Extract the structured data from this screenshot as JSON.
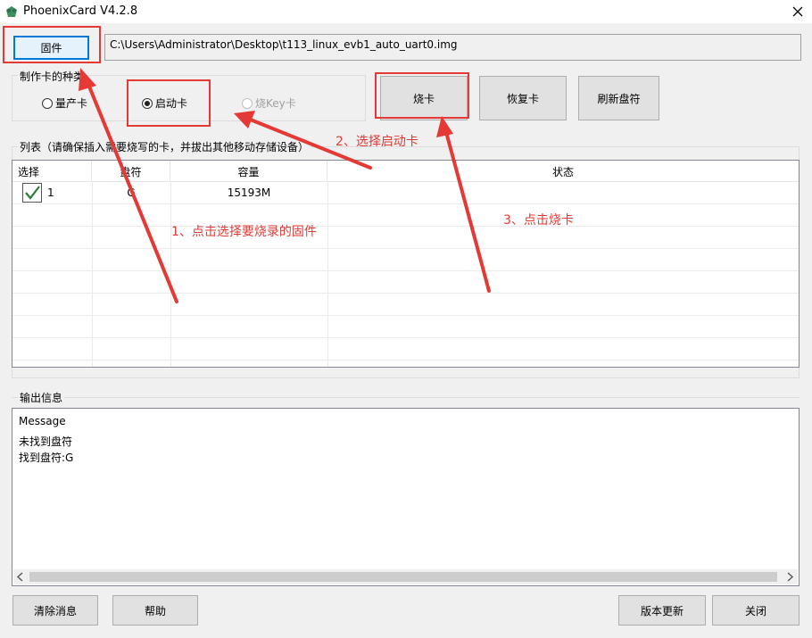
{
  "window": {
    "title": "PhoenixCard V4.2.8"
  },
  "firmware": {
    "button_label": "固件",
    "path": "C:\\Users\\Administrator\\Desktop\\t113_linux_evb1_auto_uart0.img"
  },
  "card_type": {
    "group_label": "制作卡的种类",
    "options": [
      "量产卡",
      "启动卡",
      "烧Key卡"
    ],
    "selected": "启动卡"
  },
  "actions": {
    "burn": "烧卡",
    "restore": "恢复卡",
    "refresh": "刷新盘符"
  },
  "list": {
    "group_label": "列表（请确保插入需要烧写的卡，并拔出其他移动存储设备）",
    "columns": [
      "选择",
      "盘符",
      "容量",
      "状态"
    ],
    "rows": [
      {
        "index": "1",
        "drive": "G",
        "capacity": "15193M",
        "status": "",
        "checked": true
      }
    ]
  },
  "output": {
    "group_label": "输出信息",
    "lines": [
      "Message",
      "未找到盘符",
      "找到盘符:G"
    ]
  },
  "bottom": {
    "clear": "清除消息",
    "help": "帮助",
    "update": "版本更新",
    "close": "关闭"
  },
  "annotations": {
    "step1": "1、点击选择要烧录的固件",
    "step2": "2、选择启动卡",
    "step3": "3、点击烧卡",
    "color": "#e53935"
  }
}
